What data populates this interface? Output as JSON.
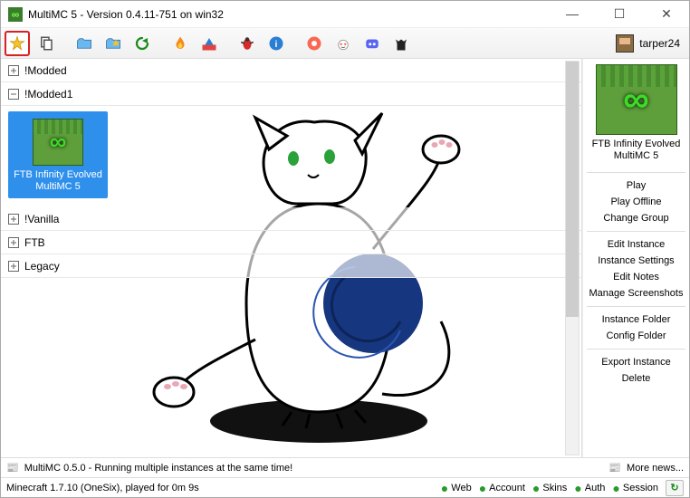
{
  "window": {
    "title": "MultiMC 5 - Version 0.4.11-751 on win32"
  },
  "toolbar": {
    "icons": [
      "new-instance",
      "copy-instance",
      "open-folder",
      "mod-folder",
      "refresh",
      "flame",
      "config",
      "bug",
      "info",
      "patreon",
      "reddit",
      "discord",
      "cat"
    ]
  },
  "user": {
    "name": "tarper24"
  },
  "groups": [
    {
      "name": "!Modded",
      "expanded": false
    },
    {
      "name": "!Modded1",
      "expanded": true
    },
    {
      "name": "!Vanilla",
      "expanded": false
    },
    {
      "name": "FTB",
      "expanded": false
    },
    {
      "name": "Legacy",
      "expanded": false
    }
  ],
  "selected_instance": {
    "label": "FTB Infinity Evolved MultiMC 5"
  },
  "side": {
    "title": "FTB Infinity Evolved MultiMC 5",
    "buttons_a": [
      "Play",
      "Play Offline",
      "Change Group"
    ],
    "buttons_b": [
      "Edit Instance",
      "Instance Settings",
      "Edit Notes",
      "Manage Screenshots"
    ],
    "buttons_c": [
      "Instance Folder",
      "Config Folder"
    ],
    "buttons_d": [
      "Export Instance",
      "Delete"
    ]
  },
  "news": {
    "text": "MultiMC 0.5.0 - Running multiple instances at the same time!",
    "more": "More news..."
  },
  "status": {
    "text": "Minecraft 1.7.10 (OneSix), played for 0m 9s",
    "services": [
      "Web",
      "Account",
      "Skins",
      "Auth",
      "Session"
    ]
  }
}
